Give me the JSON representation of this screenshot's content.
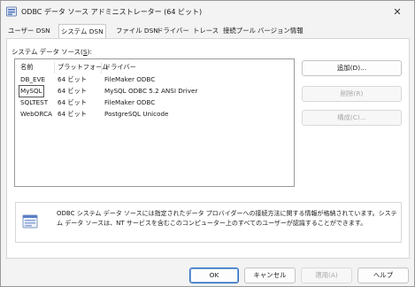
{
  "window": {
    "title": "ODBC データ ソース アドミニストレーター (64 ビット)",
    "close_glyph": "✕"
  },
  "tabs": [
    {
      "label": "ユーザー DSN",
      "active": false
    },
    {
      "label": "システム DSN",
      "active": true
    },
    {
      "label": "ファイル DSN",
      "active": false
    },
    {
      "label": "ドライバー",
      "active": false
    },
    {
      "label": "トレース",
      "active": false
    },
    {
      "label": "接続プール",
      "active": false
    },
    {
      "label": "バージョン情報",
      "active": false
    }
  ],
  "list": {
    "label_prefix": "システム データ ソース(",
    "label_key": "S",
    "label_suffix": "):",
    "columns": [
      "名前",
      "プラットフォーム",
      "ドライバー"
    ],
    "rows": [
      {
        "name": "DB_EVE",
        "platform": "64 ビット",
        "driver": "FileMaker ODBC",
        "focused": false
      },
      {
        "name": "MySQL",
        "platform": "64 ビット",
        "driver": "MySQL ODBC 5.2 ANSI Driver",
        "focused": true
      },
      {
        "name": "SQLTEST",
        "platform": "64 ビット",
        "driver": "FileMaker ODBC",
        "focused": false
      },
      {
        "name": "WebORCA",
        "platform": "64 ビット",
        "driver": "PostgreSQL Unicode",
        "focused": false
      }
    ]
  },
  "side_buttons": {
    "add": "追加(D)...",
    "remove": "削除(R)",
    "configure": "構成(C)..."
  },
  "info": {
    "text": "ODBC システム データ ソースには指定されたデータ プロバイダーへの接続方法に関する情報が格納されています。システム データ ソースは、NT サービスを含むこのコンピューター上のすべてのユーザーが認識することができます。"
  },
  "footer_buttons": {
    "ok": "OK",
    "cancel": "キャンセル",
    "apply": "適用(A)",
    "help": "ヘルプ"
  }
}
